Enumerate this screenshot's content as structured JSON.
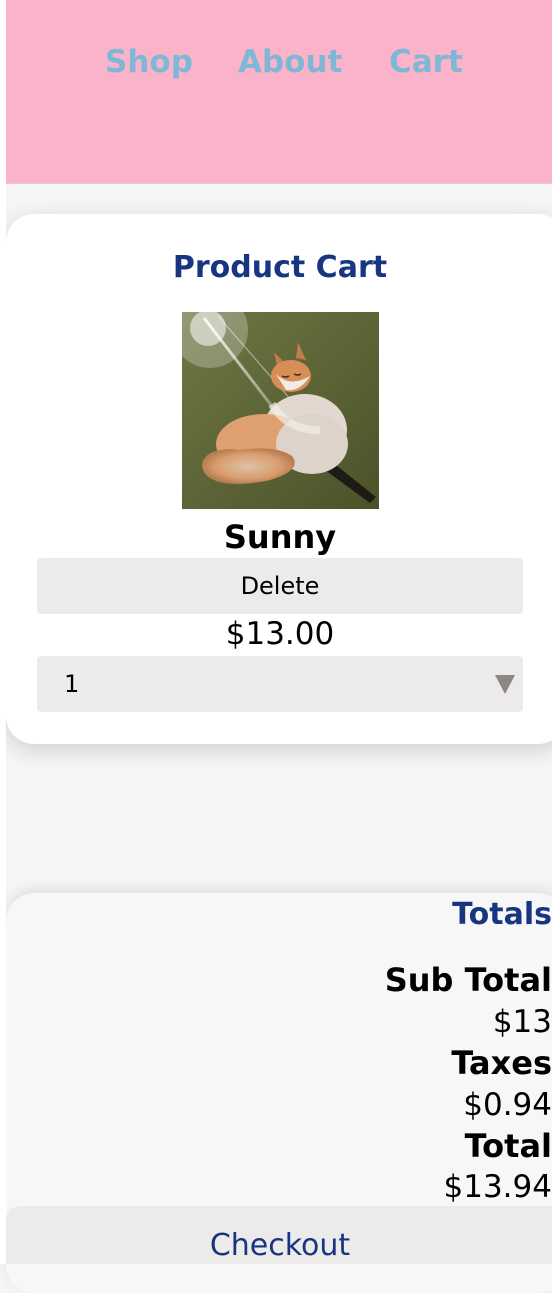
{
  "nav": {
    "links": [
      "Shop",
      "About",
      "Cart"
    ]
  },
  "cart": {
    "title": "Product Cart",
    "item": {
      "name": "Sunny",
      "delete_label": "Delete",
      "price": "$13.00",
      "quantity": "1",
      "image_icon": "fox-painting"
    }
  },
  "totals": {
    "title": "Totals",
    "subtotal_label": "Sub Total",
    "subtotal_value": "$13",
    "taxes_label": "Taxes",
    "taxes_value": "$0.94",
    "total_label": "Total",
    "total_value": "$13.94"
  },
  "checkout": {
    "label": "Checkout"
  },
  "colors": {
    "nav_background": "#fab3c8",
    "nav_link": "#7fb7d6",
    "heading": "#173580",
    "button": "#edeaea"
  }
}
